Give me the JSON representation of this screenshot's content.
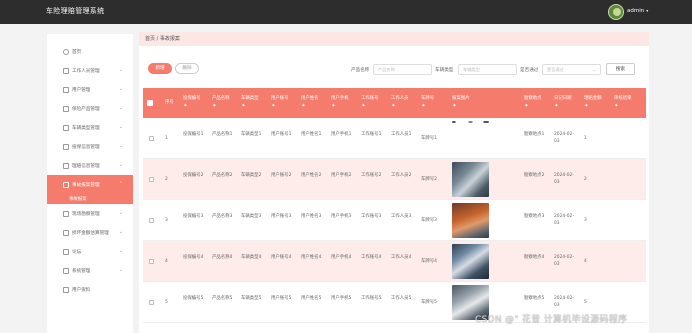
{
  "app": {
    "title": "车险理赔管理系统",
    "user": "admin",
    "caret": "▾"
  },
  "sidebar": {
    "items": [
      {
        "label": "首页",
        "icon": "home-icon"
      },
      {
        "label": "工作人员管理",
        "icon": "list-icon",
        "chev": "⌄"
      },
      {
        "label": "用户管理",
        "icon": "list-icon",
        "chev": "⌄"
      },
      {
        "label": "保险产品管理",
        "icon": "list-icon",
        "chev": "⌄"
      },
      {
        "label": "车辆类型管理",
        "icon": "list-icon",
        "chev": "⌄"
      },
      {
        "label": "投保信息管理",
        "icon": "list-icon",
        "chev": "⌄"
      },
      {
        "label": "理赔信息管理",
        "icon": "list-icon",
        "chev": "⌄"
      },
      {
        "label": "事故报案管理",
        "icon": "list-icon",
        "chev": "⌃"
      },
      {
        "label": "现场勘察管理",
        "icon": "list-icon",
        "chev": "⌄"
      },
      {
        "label": "损坏金额估算管理",
        "icon": "list-icon",
        "chev": "⌄"
      },
      {
        "label": "论坛",
        "icon": "list-icon",
        "chev": "⌄"
      },
      {
        "label": "系统管理",
        "icon": "list-icon",
        "chev": "⌄"
      },
      {
        "label": "用户资料",
        "icon": "list-icon",
        "chev": ""
      }
    ],
    "active_sub": "事故报案"
  },
  "breadcrumb": "首页 / 事故报案",
  "toolbar": {
    "add": "新增",
    "delete": "删除",
    "search": "搜索"
  },
  "filters": {
    "product_label": "产品名称",
    "product_placeholder": "产品名称",
    "cartype_label": "车辆类型",
    "cartype_placeholder": "车辆类型",
    "review_label": "是否通过",
    "review_placeholder": "是否通过",
    "review_dd": "⌄"
  },
  "table": {
    "sort_glyph": "◆",
    "headers": [
      "序号",
      "投保编号",
      "产品名称",
      "车辆类型",
      "用户账号",
      "用户姓名",
      "用户手机",
      "工作账号",
      "工作人员",
      "车牌号",
      "报案图片",
      "勘察地点",
      "日记日期",
      "理赔金额",
      "审核结果"
    ],
    "rows": [
      {
        "no": "1",
        "policy": "投保编号1",
        "product": "产品名称1",
        "cartype": "车辆类型1",
        "account": "用户账号1",
        "name": "用户姓名1",
        "phone": "用户手机1",
        "work_account": "工作账号1",
        "worker": "工作人员1",
        "plate": "车牌号1",
        "place": "勘察地点1",
        "date": "2024-02-03",
        "amount": "1",
        "photo": "accident-photo-1"
      },
      {
        "no": "2",
        "policy": "投保编号2",
        "product": "产品名称2",
        "cartype": "车辆类型2",
        "account": "用户账号2",
        "name": "用户姓名2",
        "phone": "用户手机2",
        "work_account": "工作账号2",
        "worker": "工作人员2",
        "plate": "车牌号2",
        "place": "勘察地点2",
        "date": "2024-02-03",
        "amount": "2",
        "photo": "accident-photo-2"
      },
      {
        "no": "3",
        "policy": "投保编号3",
        "product": "产品名称3",
        "cartype": "车辆类型3",
        "account": "用户账号3",
        "name": "用户姓名3",
        "phone": "用户手机3",
        "work_account": "工作账号3",
        "worker": "工作人员3",
        "plate": "车牌号3",
        "place": "勘察地点3",
        "date": "2024-02-03",
        "amount": "3",
        "photo": "accident-photo-3"
      },
      {
        "no": "4",
        "policy": "投保编号4",
        "product": "产品名称4",
        "cartype": "车辆类型4",
        "account": "用户账号4",
        "name": "用户姓名4",
        "phone": "用户手机4",
        "work_account": "工作账号4",
        "worker": "工作人员4",
        "plate": "车牌号4",
        "place": "勘察地点4",
        "date": "2024-02-03",
        "amount": "4",
        "photo": "accident-photo-4"
      },
      {
        "no": "5",
        "policy": "投保编号5",
        "product": "产品名称5",
        "cartype": "车辆类型5",
        "account": "用户账号5",
        "name": "用户姓名5",
        "phone": "用户手机5",
        "work_account": "工作账号5",
        "worker": "工作人员5",
        "plate": "车牌号5",
        "place": "勘察地点5",
        "date": "2024-02-03",
        "amount": "5",
        "photo": "accident-photo-5"
      }
    ]
  },
  "watermark": "CSDN @\" 花昔 计算机毕设源码程序",
  "colors": {
    "topbar": "#2d2d2d",
    "accent": "#f57c6d",
    "accent_light": "#fde7e4"
  }
}
